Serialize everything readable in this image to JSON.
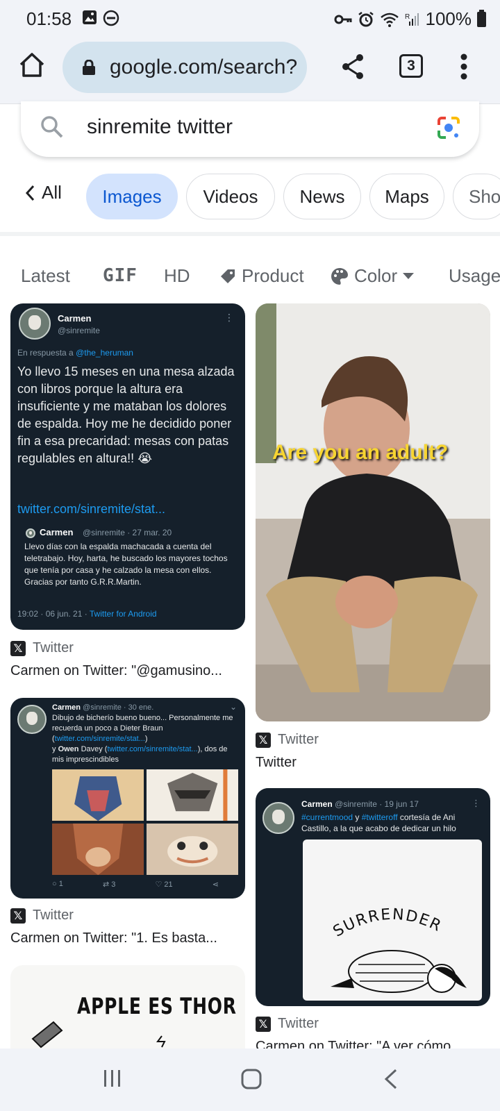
{
  "status_bar": {
    "time": "01:58",
    "battery": "100%",
    "network_label": "R"
  },
  "browser": {
    "url": "google.com/search?",
    "tab_count": "3"
  },
  "search": {
    "query": "sinremite twitter"
  },
  "tabs": {
    "back_label": "All",
    "items": [
      "Images",
      "Videos",
      "News",
      "Maps",
      "Sho"
    ]
  },
  "filters": [
    "Latest",
    "GIF",
    "HD",
    "Product",
    "Color",
    "Usage"
  ],
  "results": [
    {
      "source": "Twitter",
      "title": "Carmen on Twitter: \"@gamusino...",
      "tweet": {
        "name": "Carmen",
        "handle": "@sinremite",
        "reply_prefix": "En respuesta a",
        "reply_to": "@the_heruman",
        "text": "Yo llevo 15 meses en una mesa alzada con libros porque la altura era insuficiente y me mataban los dolores de espalda. Hoy me he decidido poner fin a esa precaridad: mesas con patas regulables en altura!! 😭",
        "link": "twitter.com/sinremite/stat...",
        "quoted_name": "Carmen",
        "quoted_handle": "@sinremite · 27 mar. 20",
        "quoted_text": "Llevo días con la espalda machacada a cuenta del teletrabajo. Hoy, harta, he buscado los mayores tochos que tenía por casa y he calzado la mesa con ellos. Gracias por tanto G.R.R.Martin.",
        "footer_time": "19:02 · 06 jun. 21 ·",
        "footer_client": "Twitter for Android"
      }
    },
    {
      "source": "Twitter",
      "title": "Twitter",
      "caption": "Are you an adult?"
    },
    {
      "source": "Twitter",
      "title": "Carmen on Twitter: \"1. Es basta...",
      "tweet": {
        "name": "Carmen",
        "handle": "@sinremite · 30 ene.",
        "text_1": "Dibujo de bicherío bueno bueno... Personalmente me recuerda un poco a Dieter Braun (",
        "link_1": "twitter.com/sinremite/stat...",
        "text_2": ")",
        "text_3": " y ",
        "owen": "Owen",
        "text_4": " Davey (",
        "link_2": "twitter.com/sinremite/stat...",
        "text_5": "), dos de mis imprescindibles",
        "replies": "1",
        "retweets": "3",
        "likes": "21"
      }
    },
    {
      "source": "Twitter",
      "title": "Carmen on Twitter: \"A ver cómo...",
      "tweet": {
        "name": "Carmen",
        "handle": "@sinremite · 19 jun 17",
        "hashtag_1": "#currentmood",
        "joiner": " y ",
        "hashtag_2": "#twitteroff",
        "text": " cortesía de Ani Castillo, a la que acabo de dedicar un hilo",
        "drawing_word": "SURRENDER"
      }
    },
    {
      "drawing_text": "APPLE ES THOR"
    }
  ]
}
